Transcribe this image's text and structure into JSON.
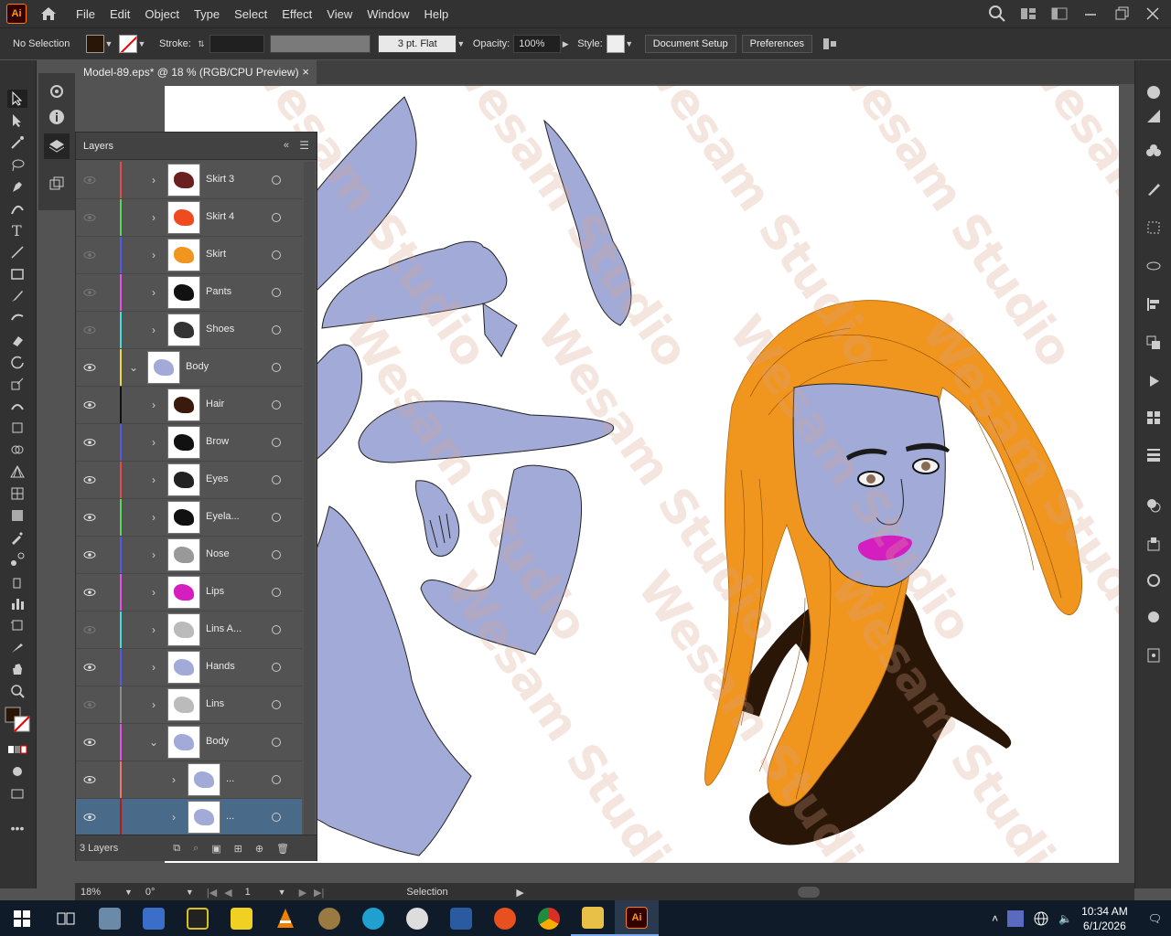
{
  "app": {
    "logo": "Ai",
    "home_icon": "home-icon"
  },
  "menu": [
    "File",
    "Edit",
    "Object",
    "Type",
    "Select",
    "Effect",
    "View",
    "Window",
    "Help"
  ],
  "control": {
    "selection": "No Selection",
    "stroke_label": "Stroke:",
    "brush": "3 pt. Flat",
    "opacity_label": "Opacity:",
    "opacity": "100%",
    "style_label": "Style:",
    "document_setup": "Document Setup",
    "preferences": "Preferences"
  },
  "document": {
    "tab_title": "Model-89.eps* @ 18 % (RGB/CPU Preview)",
    "close": "×"
  },
  "layers_panel": {
    "title": "Layers",
    "footer_count": "3 Layers",
    "rows": [
      {
        "name": "Skirt 3",
        "color": "#e8494f",
        "visible": false
      },
      {
        "name": "Skirt 4",
        "color": "#5fd35a",
        "visible": false
      },
      {
        "name": "Skirt",
        "color": "#5858e8",
        "visible": false
      },
      {
        "name": "Pants",
        "color": "#e850e8",
        "visible": false
      },
      {
        "name": "Shoes",
        "color": "#4fd8d8",
        "visible": false
      },
      {
        "name": "Body",
        "color": "#e8d84a",
        "visible": true
      },
      {
        "name": "Hair",
        "color": "#111111",
        "visible": true
      },
      {
        "name": "Brow",
        "color": "#5858e8",
        "visible": true
      },
      {
        "name": "Eyes",
        "color": "#e8494f",
        "visible": true
      },
      {
        "name": "Eyela...",
        "color": "#5fd35a",
        "visible": true
      },
      {
        "name": "Nose",
        "color": "#5858e8",
        "visible": true
      },
      {
        "name": "Lips",
        "color": "#e850e8",
        "visible": true
      },
      {
        "name": "Lins A...",
        "color": "#4fd8d8",
        "visible": false
      },
      {
        "name": "Hands",
        "color": "#5858e8",
        "visible": true
      },
      {
        "name": "Lins",
        "color": "#8a8a8a",
        "visible": false
      },
      {
        "name": "Body",
        "color": "#e850e8",
        "visible": true
      },
      {
        "name": "...",
        "color": "#e8786f",
        "visible": true
      },
      {
        "name": "...",
        "color": "#b81a1a",
        "visible": true
      }
    ]
  },
  "status": {
    "zoom": "18%",
    "rotation": "0°",
    "page": "1",
    "tool": "Selection"
  },
  "taskbar": {
    "time": "10:34 AM",
    "date": "6/1/2026"
  },
  "watermark": "Wesam Studio",
  "colors": {
    "accent_ai": "#ff9a00",
    "body_fill": "#a2abd8",
    "hair_orange": "#f0961e",
    "hair_dark": "#2a1606",
    "lips": "#d41ec0"
  }
}
